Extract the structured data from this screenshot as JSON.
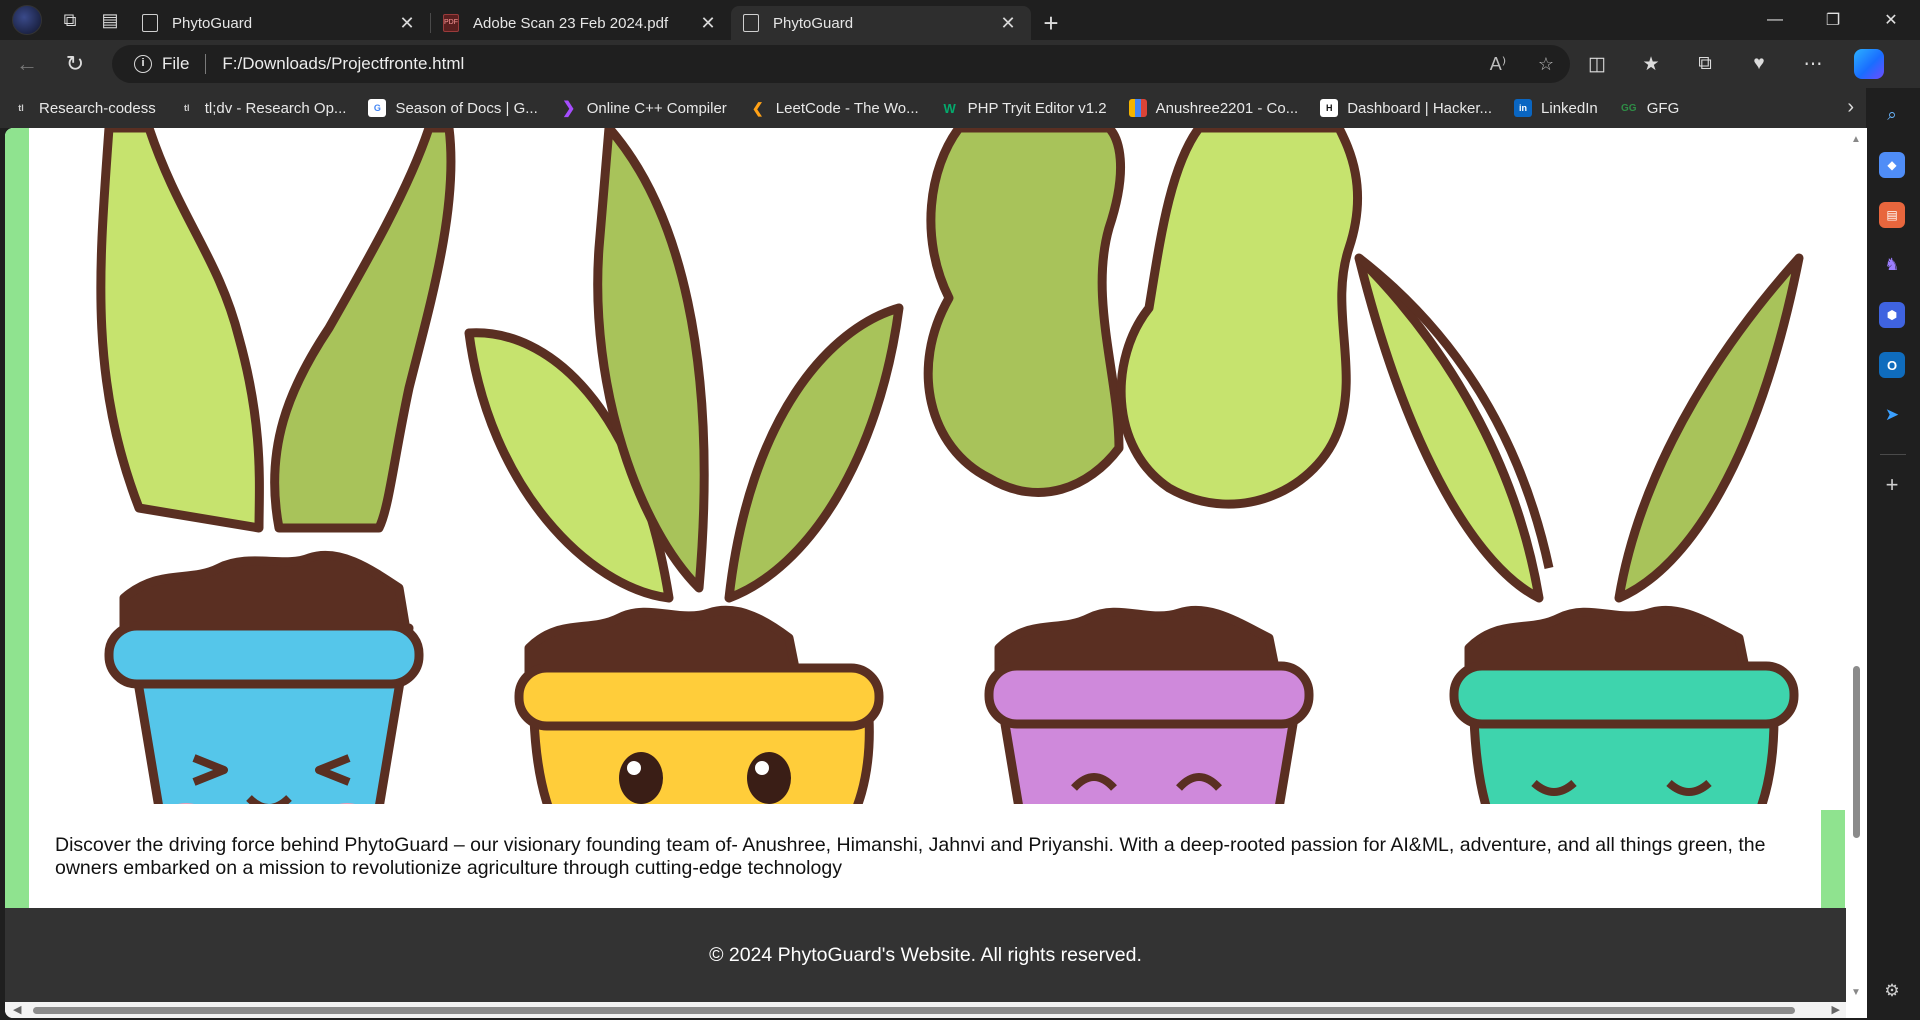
{
  "tabs": [
    {
      "label": "PhytoGuard",
      "active": false,
      "icon": "page-icon"
    },
    {
      "label": "Adobe Scan 23 Feb 2024.pdf",
      "active": false,
      "icon": "pdf-icon"
    },
    {
      "label": "PhytoGuard",
      "active": true,
      "icon": "page-icon"
    }
  ],
  "address": {
    "scheme_label": "File",
    "url": "F:/Downloads/Projectfronte.html"
  },
  "favorites": [
    {
      "label": "Research-codess",
      "icon": "tldv-icon"
    },
    {
      "label": "tl;dv - Research Op...",
      "icon": "tldv-icon"
    },
    {
      "label": "Season of Docs  |  G...",
      "icon": "google-icon"
    },
    {
      "label": "Online C++ Compiler",
      "icon": "compiler-icon"
    },
    {
      "label": "LeetCode - The Wo...",
      "icon": "leetcode-icon"
    },
    {
      "label": "PHP Tryit Editor v1.2",
      "icon": "w3schools-icon"
    },
    {
      "label": "Anushree2201 - Co...",
      "icon": "chart-icon"
    },
    {
      "label": "Dashboard | Hacker...",
      "icon": "hackerrank-icon"
    },
    {
      "label": "LinkedIn",
      "icon": "linkedin-icon"
    },
    {
      "label": "GFG",
      "icon": "gfg-icon"
    }
  ],
  "page": {
    "about": "Discover the driving force behind PhytoGuard – our visionary founding team of- Anushree, Himanshi, Jahnvi and Priyanshi. With a deep-rooted passion for AI&ML, adventure, and all things green, the owners embarked on a mission to revolutionize agriculture through cutting-edge technology",
    "footer": "© 2024 PhytoGuard's Website. All rights reserved."
  },
  "colors": {
    "accent_green": "#8fe38f",
    "footer_bg": "#333333",
    "pot_blue": "#55c6ea",
    "pot_yellow": "#ffcd3a",
    "pot_purple": "#cf89db",
    "pot_teal": "#3ed4ad",
    "leaf_light": "#c6e36e",
    "leaf_dark": "#a8c35a",
    "outline": "#5a2f22"
  }
}
